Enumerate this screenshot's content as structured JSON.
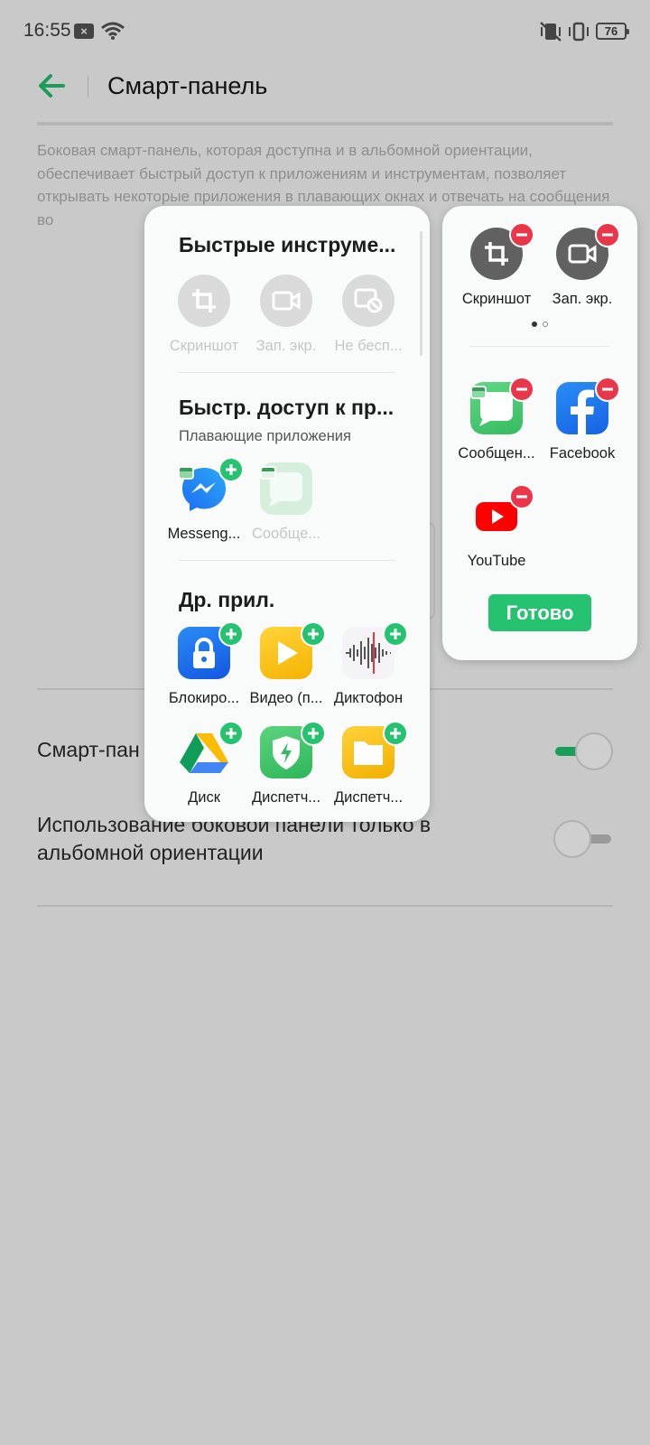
{
  "status_bar": {
    "time": "16:55",
    "battery": "76"
  },
  "header": {
    "title": "Смарт-панель"
  },
  "description": "Боковая смарт-панель, которая доступна и в альбомной ориентации, обеспечивает быстрый доступ к приложениям и инструментам, позволяет открывать некоторые приложения в плавающих окнах и отвечать на сообщения во",
  "settings": [
    {
      "label": "Смарт-пан",
      "enabled": true
    },
    {
      "label": "Использование боковой панели только в альбомной ориентации",
      "enabled": false
    }
  ],
  "left_sheet": {
    "quick_tools": {
      "title": "Быстрые инструме...",
      "items": [
        {
          "label": "Скриншот",
          "icon": "crop-icon"
        },
        {
          "label": "Зап. экр.",
          "icon": "video-record-icon"
        },
        {
          "label": "Не бесп...",
          "icon": "do-not-disturb-icon"
        }
      ]
    },
    "quick_access": {
      "title": "Быстр. доступ к пр...",
      "subtitle": "Плавающие приложения",
      "items": [
        {
          "label": "Messeng...",
          "icon": "messenger-icon"
        },
        {
          "label": "Сообще...",
          "icon": "messages-icon"
        }
      ]
    },
    "other_apps": {
      "title": "Др. прил.",
      "items": [
        {
          "label": "Блокиро...",
          "icon": "app-lock-icon"
        },
        {
          "label": "Видео (п...",
          "icon": "video-player-icon"
        },
        {
          "label": "Диктофон",
          "icon": "voice-recorder-icon"
        },
        {
          "label": "Диск",
          "icon": "google-drive-icon"
        },
        {
          "label": "Диспетч...",
          "icon": "phone-manager-icon"
        },
        {
          "label": "Диспетч...",
          "icon": "file-manager-icon"
        }
      ]
    }
  },
  "right_sheet": {
    "tools": [
      {
        "label": "Скриншот",
        "icon": "crop-icon"
      },
      {
        "label": "Зап. экр.",
        "icon": "video-record-icon"
      }
    ],
    "apps": [
      {
        "label": "Сообщен...",
        "icon": "messages-icon"
      },
      {
        "label": "Facebook",
        "icon": "facebook-icon"
      },
      {
        "label": "YouTube",
        "icon": "youtube-icon"
      }
    ],
    "done_label": "Готово"
  },
  "colors": {
    "accent": "#25c26f",
    "remove": "#e8364a",
    "back_arrow": "#1a9c5a"
  }
}
